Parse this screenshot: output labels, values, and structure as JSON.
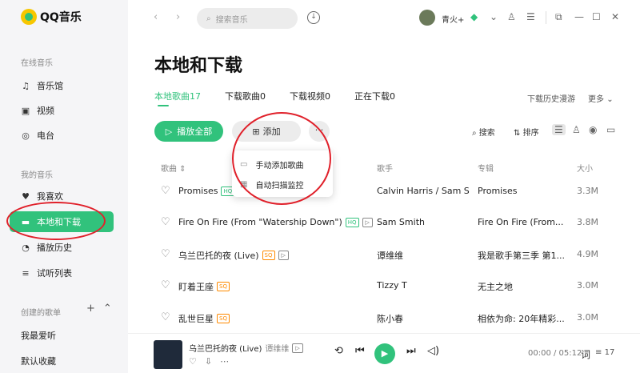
{
  "app": {
    "name": "QQ音乐"
  },
  "sidebar": {
    "online_section": "在线音乐",
    "online_items": [
      {
        "label": "音乐馆",
        "icon": "music-note-icon"
      },
      {
        "label": "视频",
        "icon": "video-icon"
      },
      {
        "label": "电台",
        "icon": "radio-icon"
      }
    ],
    "my_section": "我的音乐",
    "my_items": [
      {
        "label": "我喜欢",
        "icon": "heart-icon"
      },
      {
        "label": "本地和下载",
        "icon": "monitor-icon",
        "active": true
      },
      {
        "label": "播放历史",
        "icon": "clock-icon"
      },
      {
        "label": "试听列表",
        "icon": "playlist-icon"
      }
    ],
    "created_section": "创建的歌单",
    "created_items": [
      "我最爱听",
      "默认收藏"
    ]
  },
  "topbar": {
    "search_placeholder": "搜索音乐",
    "username": "青火+"
  },
  "page": {
    "title": "本地和下载",
    "tabs": [
      {
        "label": "本地歌曲17",
        "active": true
      },
      {
        "label": "下载歌曲0"
      },
      {
        "label": "下载视频0"
      },
      {
        "label": "正在下载0"
      }
    ],
    "download_history": "下载历史漫游",
    "more": "更多"
  },
  "toolbar": {
    "play_all": "播放全部",
    "add": "添加",
    "more": "···",
    "search": "搜索",
    "sort": "排序"
  },
  "add_menu": {
    "items": [
      "手动添加歌曲",
      "自动扫描监控"
    ]
  },
  "table": {
    "columns": {
      "song": "歌曲 ⇕",
      "artist": "歌手",
      "album": "专辑",
      "size": "大小"
    },
    "rows": [
      {
        "title": "Promises",
        "badge": "HQ",
        "mv": false,
        "artist": "Calvin Harris / Sam S...",
        "album": "Promises",
        "size": "3.3M"
      },
      {
        "title": "Fire On Fire (From \"Watership Down\")",
        "badge": "HQ",
        "mv": true,
        "artist": "Sam Smith",
        "album": "Fire On Fire (From...",
        "size": "3.8M"
      },
      {
        "title": "乌兰巴托的夜 (Live)",
        "badge": "SQ",
        "mv": true,
        "artist": "谭维维",
        "album": "我是歌手第三季 第1...",
        "size": "4.9M"
      },
      {
        "title": "盯着王座",
        "badge": "SQ",
        "mv": false,
        "artist": "Tizzy T",
        "album": "无主之地",
        "size": "3.0M"
      },
      {
        "title": "乱世巨星",
        "badge": "SQ",
        "mv": false,
        "artist": "陈小春",
        "album": "相依为命: 20年精彩...",
        "size": "3.0M"
      }
    ]
  },
  "player": {
    "song": "乌兰巴托的夜 (Live)",
    "artist": "谭维维",
    "time": "00:00 / 05:12",
    "lyric": "词",
    "playlist_count": "17"
  },
  "colors": {
    "accent": "#31c27c",
    "highlight_circle": "#e0212b"
  }
}
